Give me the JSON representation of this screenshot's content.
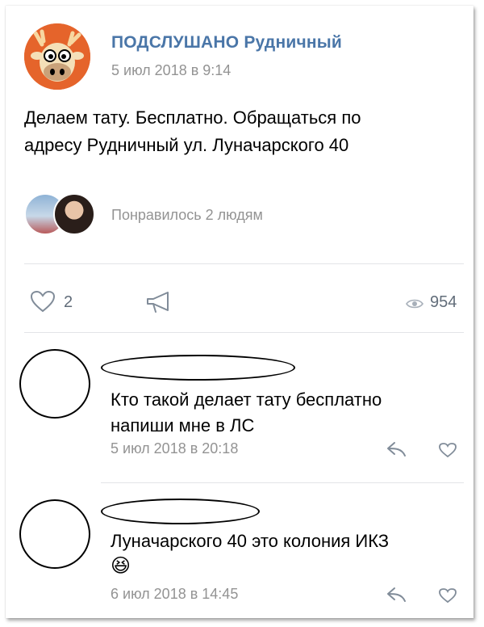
{
  "post": {
    "group_name": "ПОДСЛУШАНО Рудничный",
    "date": "5 июл 2018 в 9:14",
    "text_line1": "Делаем тату. Бесплатно. Обращаться по",
    "text_line2": "адресу Рудничный ул.  Луначарского 40",
    "likes_summary": "Понравилось 2 людям",
    "like_count": "2",
    "views_count": "954"
  },
  "comments": [
    {
      "text_line1": "Кто такой делает тату бесплатно",
      "text_line2": "напиши мне в ЛС",
      "date": "5 июл 2018 в 20:18"
    },
    {
      "text_line1": "Луначарского 40 это колония ИКЗ",
      "emoji": "😆",
      "date": "6 июл 2018 в 14:45"
    }
  ],
  "colors": {
    "link_blue": "#4a76a8",
    "meta_gray": "#939393",
    "icon_gray": "#818c99",
    "avatar_orange": "#e5642b"
  },
  "icons": [
    "like-heart-icon",
    "share-megaphone-icon",
    "views-eye-icon",
    "reply-arrow-icon",
    "comment-like-heart-icon"
  ]
}
